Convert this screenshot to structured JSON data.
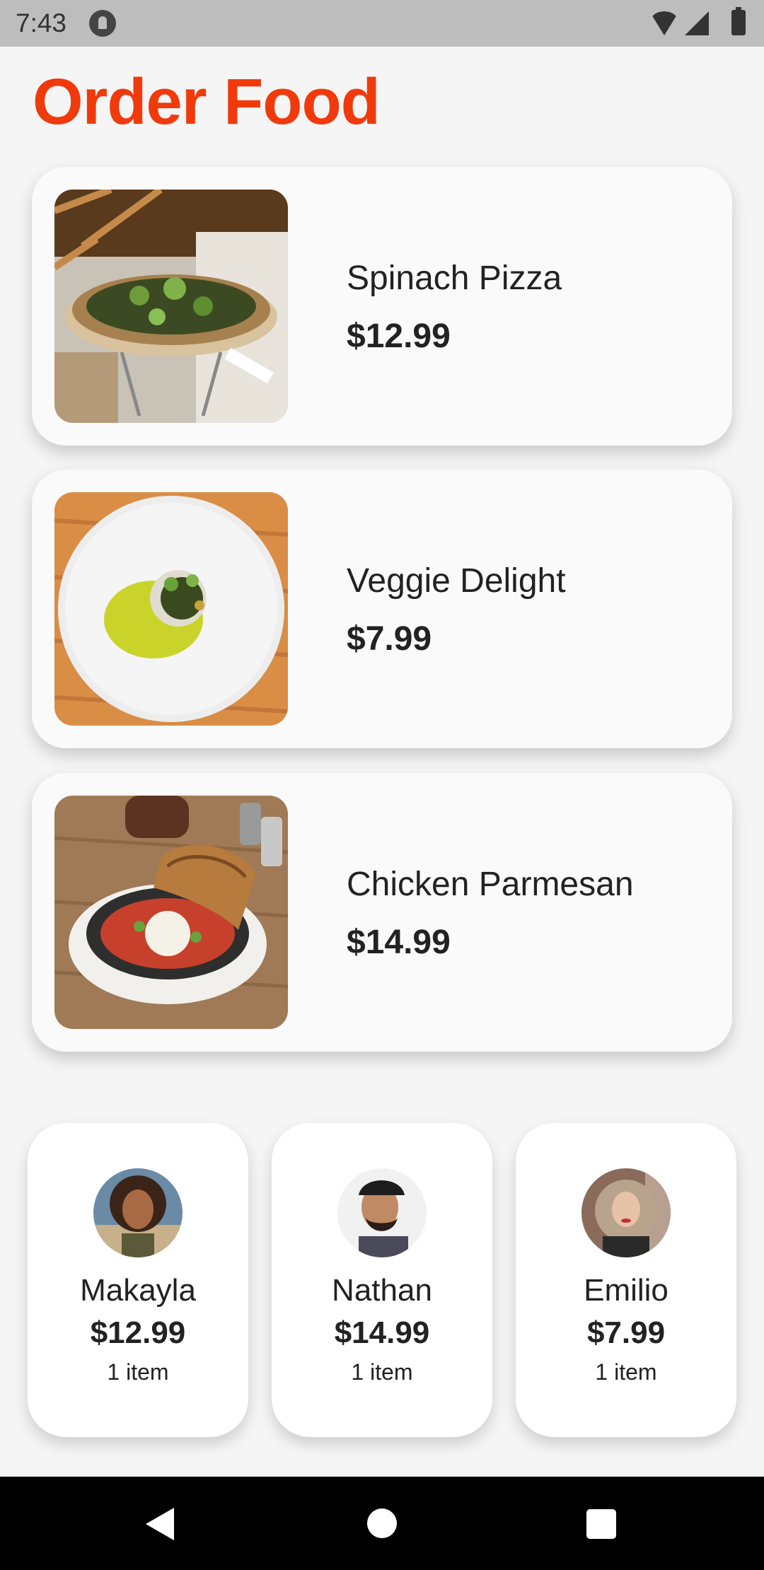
{
  "status_bar": {
    "time": "7:43"
  },
  "header": {
    "title": "Order Food"
  },
  "menu": [
    {
      "name": "Spinach Pizza",
      "price": "$12.99"
    },
    {
      "name": "Veggie Delight",
      "price": "$7.99"
    },
    {
      "name": "Chicken Parmesan",
      "price": "$14.99"
    }
  ],
  "orders": [
    {
      "name": "Makayla",
      "total": "$12.99",
      "items": "1 item"
    },
    {
      "name": "Nathan",
      "total": "$14.99",
      "items": "1 item"
    },
    {
      "name": "Emilio",
      "total": "$7.99",
      "items": "1 item"
    }
  ],
  "colors": {
    "accent": "#f03a0c",
    "status_bar": "#bdbdbd",
    "nav_bar": "#000000"
  },
  "icons": [
    "wifi-icon",
    "cellular-signal-icon",
    "battery-icon",
    "back-icon",
    "home-icon",
    "recents-icon"
  ]
}
